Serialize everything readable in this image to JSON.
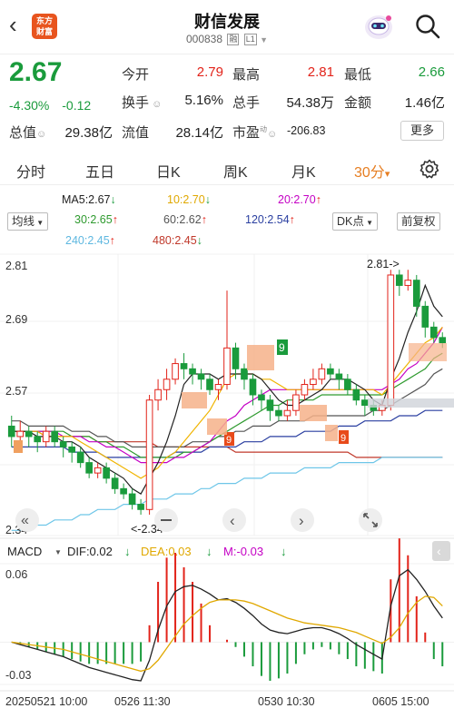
{
  "header": {
    "back_glyph": "‹",
    "app_logo": "东方财富",
    "stock_name": "财信发展",
    "stock_code": "000838",
    "badge_rong": "融",
    "badge_level": "L1",
    "search_icon": "search-icon",
    "assistant_icon": "robot-icon"
  },
  "quote": {
    "price": "2.67",
    "change_pct": "-4.30%",
    "change_amt": "-0.12",
    "open_label": "今开",
    "open": "2.79",
    "high_label": "最高",
    "high": "2.81",
    "low_label": "最低",
    "low": "2.66",
    "turnover_label": "换手",
    "turnover": "5.16%",
    "volume_label": "总手",
    "volume": "54.38万",
    "amount_label": "金额",
    "amount": "1.46亿",
    "mktcap_label": "总值",
    "mktcap": "29.38亿",
    "float_label": "流值",
    "float": "28.14亿",
    "pe_label": "市盈",
    "pe_sup": "动",
    "pe": "-206.83",
    "more_label": "更多",
    "colors": {
      "up": "#e2231a",
      "down": "#1a9b3c"
    }
  },
  "tabs": {
    "items": [
      "分时",
      "五日",
      "日K",
      "周K",
      "月K"
    ],
    "active": "30分",
    "active_arrow": "▾",
    "settings_icon": "gear-icon"
  },
  "indicators": {
    "ma_type": "均线",
    "ma5": "MA5:2.67",
    "ma10": "10:2.70",
    "ma20": "20:2.70",
    "ma30": "30:2.65",
    "ma60": "60:2.62",
    "ma120": "120:2.54",
    "ma240": "240:2.45",
    "ma480": "480:2.45",
    "dk_label": "DK点",
    "fq_label": "前复权",
    "colors": {
      "ma5": "#222222",
      "ma10": "#f0b400",
      "ma20": "#c400c4",
      "ma30": "#2e9a2e",
      "ma60": "#555555",
      "ma120": "#2a3fa0",
      "ma240": "#6ec6e8",
      "ma480": "#c0392b"
    }
  },
  "kchart": {
    "y_labels": [
      "2.81",
      "2.69",
      "2.57",
      "2.34"
    ],
    "high_marker": "2.81->",
    "low_marker": "<-2.34",
    "tick_9": "9",
    "nav_left_double": "«",
    "nav_left": "‹",
    "nav_right": "›",
    "nav_right_double": "»",
    "expand_icon": "expand-icon"
  },
  "macd": {
    "name": "MACD",
    "dif": "DIF:0.02",
    "dea": "DEA:0.03",
    "m": "M:-0.03",
    "y_top": "0.06",
    "y_bottom": "-0.03",
    "collapse_icon": "chevron-left-icon"
  },
  "timeline": {
    "labels": [
      "20250521 10:00",
      "0526 11:30",
      "0530 10:30",
      "0605 15:00"
    ]
  },
  "chart_data": {
    "type": "candlestick",
    "title": "",
    "y_range": [
      2.3,
      2.84
    ],
    "candles": [
      [
        2.51,
        2.49,
        2.53,
        2.47
      ],
      [
        2.49,
        2.5,
        2.52,
        2.48
      ],
      [
        2.5,
        2.49,
        2.51,
        2.47
      ],
      [
        2.49,
        2.48,
        2.5,
        2.46
      ],
      [
        2.48,
        2.5,
        2.51,
        2.47
      ],
      [
        2.5,
        2.48,
        2.51,
        2.47
      ],
      [
        2.48,
        2.47,
        2.49,
        2.45
      ],
      [
        2.47,
        2.46,
        2.48,
        2.44
      ],
      [
        2.46,
        2.44,
        2.47,
        2.43
      ],
      [
        2.44,
        2.42,
        2.45,
        2.41
      ],
      [
        2.42,
        2.43,
        2.44,
        2.41
      ],
      [
        2.43,
        2.41,
        2.44,
        2.4
      ],
      [
        2.41,
        2.39,
        2.42,
        2.38
      ],
      [
        2.39,
        2.38,
        2.4,
        2.37
      ],
      [
        2.38,
        2.36,
        2.39,
        2.35
      ],
      [
        2.36,
        2.35,
        2.37,
        2.34
      ],
      [
        2.35,
        2.56,
        2.57,
        2.34
      ],
      [
        2.56,
        2.58,
        2.6,
        2.54
      ],
      [
        2.58,
        2.6,
        2.62,
        2.56
      ],
      [
        2.6,
        2.63,
        2.64,
        2.59
      ],
      [
        2.63,
        2.62,
        2.65,
        2.6
      ],
      [
        2.62,
        2.61,
        2.63,
        2.59
      ],
      [
        2.61,
        2.6,
        2.62,
        2.58
      ],
      [
        2.6,
        2.58,
        2.61,
        2.57
      ],
      [
        2.58,
        2.59,
        2.6,
        2.56
      ],
      [
        2.59,
        2.66,
        2.77,
        2.58
      ],
      [
        2.66,
        2.62,
        2.67,
        2.6
      ],
      [
        2.62,
        2.6,
        2.63,
        2.58
      ],
      [
        2.6,
        2.57,
        2.61,
        2.55
      ],
      [
        2.57,
        2.56,
        2.58,
        2.54
      ],
      [
        2.56,
        2.54,
        2.57,
        2.52
      ],
      [
        2.54,
        2.53,
        2.55,
        2.52
      ],
      [
        2.53,
        2.54,
        2.56,
        2.52
      ],
      [
        2.54,
        2.57,
        2.58,
        2.53
      ],
      [
        2.57,
        2.59,
        2.6,
        2.56
      ],
      [
        2.59,
        2.6,
        2.62,
        2.58
      ],
      [
        2.6,
        2.62,
        2.63,
        2.59
      ],
      [
        2.62,
        2.61,
        2.63,
        2.6
      ],
      [
        2.61,
        2.6,
        2.62,
        2.58
      ],
      [
        2.6,
        2.58,
        2.61,
        2.57
      ],
      [
        2.58,
        2.56,
        2.59,
        2.55
      ],
      [
        2.56,
        2.55,
        2.57,
        2.53
      ],
      [
        2.55,
        2.54,
        2.56,
        2.53
      ],
      [
        2.54,
        2.55,
        2.56,
        2.53
      ],
      [
        2.55,
        2.8,
        2.81,
        2.54
      ],
      [
        2.8,
        2.78,
        2.81,
        2.76
      ],
      [
        2.78,
        2.79,
        2.81,
        2.77
      ],
      [
        2.79,
        2.74,
        2.8,
        2.72
      ],
      [
        2.74,
        2.7,
        2.75,
        2.68
      ],
      [
        2.7,
        2.68,
        2.71,
        2.67
      ],
      [
        2.68,
        2.67,
        2.69,
        2.66
      ]
    ],
    "ma5": [
      2.5,
      2.5,
      2.5,
      2.49,
      2.49,
      2.49,
      2.48,
      2.48,
      2.47,
      2.45,
      2.44,
      2.43,
      2.42,
      2.41,
      2.39,
      2.38,
      2.41,
      2.44,
      2.48,
      2.53,
      2.59,
      2.61,
      2.61,
      2.61,
      2.6,
      2.61,
      2.61,
      2.61,
      2.61,
      2.6,
      2.58,
      2.56,
      2.55,
      2.55,
      2.56,
      2.57,
      2.58,
      2.6,
      2.6,
      2.6,
      2.59,
      2.58,
      2.56,
      2.55,
      2.6,
      2.64,
      2.69,
      2.73,
      2.78,
      2.74,
      2.72
    ],
    "ma10": [
      2.5,
      2.5,
      2.5,
      2.5,
      2.49,
      2.49,
      2.49,
      2.49,
      2.48,
      2.47,
      2.46,
      2.45,
      2.44,
      2.43,
      2.42,
      2.41,
      2.42,
      2.43,
      2.45,
      2.46,
      2.48,
      2.5,
      2.52,
      2.54,
      2.57,
      2.6,
      2.61,
      2.61,
      2.61,
      2.6,
      2.6,
      2.59,
      2.58,
      2.58,
      2.58,
      2.58,
      2.58,
      2.58,
      2.58,
      2.58,
      2.58,
      2.58,
      2.58,
      2.57,
      2.59,
      2.61,
      2.63,
      2.65,
      2.67,
      2.68,
      2.7
    ],
    "ma20": [
      2.5,
      2.5,
      2.5,
      2.5,
      2.5,
      2.5,
      2.49,
      2.49,
      2.49,
      2.48,
      2.48,
      2.47,
      2.47,
      2.46,
      2.45,
      2.44,
      2.44,
      2.44,
      2.44,
      2.45,
      2.45,
      2.46,
      2.47,
      2.48,
      2.5,
      2.52,
      2.53,
      2.55,
      2.56,
      2.57,
      2.58,
      2.58,
      2.58,
      2.58,
      2.58,
      2.58,
      2.58,
      2.58,
      2.58,
      2.58,
      2.58,
      2.58,
      2.58,
      2.58,
      2.59,
      2.6,
      2.62,
      2.63,
      2.65,
      2.67,
      2.7
    ],
    "ma30": [
      2.5,
      2.5,
      2.5,
      2.5,
      2.5,
      2.5,
      2.5,
      2.49,
      2.49,
      2.49,
      2.48,
      2.48,
      2.47,
      2.47,
      2.46,
      2.45,
      2.45,
      2.45,
      2.45,
      2.45,
      2.46,
      2.46,
      2.47,
      2.48,
      2.49,
      2.5,
      2.51,
      2.52,
      2.53,
      2.54,
      2.55,
      2.55,
      2.56,
      2.56,
      2.56,
      2.56,
      2.57,
      2.57,
      2.57,
      2.57,
      2.57,
      2.57,
      2.57,
      2.57,
      2.58,
      2.59,
      2.6,
      2.61,
      2.62,
      2.64,
      2.65
    ],
    "ma60": [
      2.52,
      2.52,
      2.51,
      2.51,
      2.51,
      2.51,
      2.51,
      2.5,
      2.5,
      2.5,
      2.49,
      2.49,
      2.48,
      2.48,
      2.47,
      2.47,
      2.47,
      2.47,
      2.47,
      2.47,
      2.47,
      2.48,
      2.48,
      2.48,
      2.49,
      2.49,
      2.5,
      2.5,
      2.51,
      2.51,
      2.51,
      2.52,
      2.52,
      2.52,
      2.52,
      2.53,
      2.53,
      2.53,
      2.53,
      2.53,
      2.53,
      2.53,
      2.54,
      2.54,
      2.55,
      2.56,
      2.57,
      2.58,
      2.59,
      2.61,
      2.62
    ],
    "ma120": [
      2.47,
      2.47,
      2.47,
      2.47,
      2.47,
      2.47,
      2.47,
      2.46,
      2.46,
      2.46,
      2.46,
      2.45,
      2.45,
      2.45,
      2.45,
      2.45,
      2.45,
      2.45,
      2.45,
      2.46,
      2.46,
      2.46,
      2.46,
      2.47,
      2.47,
      2.47,
      2.47,
      2.48,
      2.48,
      2.48,
      2.49,
      2.49,
      2.49,
      2.49,
      2.5,
      2.5,
      2.5,
      2.5,
      2.51,
      2.51,
      2.51,
      2.52,
      2.52,
      2.52,
      2.52,
      2.53,
      2.53,
      2.53,
      2.54,
      2.54,
      2.54
    ],
    "ma240": [
      2.31,
      2.31,
      2.32,
      2.32,
      2.32,
      2.33,
      2.33,
      2.33,
      2.34,
      2.34,
      2.35,
      2.35,
      2.35,
      2.36,
      2.36,
      2.36,
      2.37,
      2.37,
      2.37,
      2.38,
      2.38,
      2.38,
      2.39,
      2.39,
      2.4,
      2.4,
      2.4,
      2.41,
      2.41,
      2.41,
      2.42,
      2.42,
      2.42,
      2.42,
      2.43,
      2.43,
      2.43,
      2.43,
      2.44,
      2.44,
      2.44,
      2.44,
      2.44,
      2.45,
      2.45,
      2.45,
      2.45,
      2.45,
      2.45,
      2.45,
      2.45
    ],
    "ma480": [
      2.5,
      2.5,
      2.5,
      2.5,
      2.49,
      2.49,
      2.49,
      2.49,
      2.49,
      2.49,
      2.48,
      2.48,
      2.48,
      2.48,
      2.48,
      2.48,
      2.48,
      2.47,
      2.47,
      2.47,
      2.47,
      2.47,
      2.47,
      2.47,
      2.47,
      2.47,
      2.46,
      2.46,
      2.46,
      2.46,
      2.46,
      2.46,
      2.46,
      2.46,
      2.46,
      2.46,
      2.46,
      2.46,
      2.46,
      2.46,
      2.45,
      2.45,
      2.45,
      2.45,
      2.45,
      2.45,
      2.45,
      2.45,
      2.45,
      2.45,
      2.45
    ],
    "macd_range": [
      -0.035,
      0.065
    ],
    "dif": [
      0.0,
      -0.002,
      -0.004,
      -0.006,
      -0.008,
      -0.01,
      -0.012,
      -0.015,
      -0.018,
      -0.021,
      -0.023,
      -0.025,
      -0.027,
      -0.029,
      -0.031,
      -0.032,
      -0.015,
      0.01,
      0.03,
      0.042,
      0.046,
      0.047,
      0.044,
      0.04,
      0.035,
      0.036,
      0.033,
      0.028,
      0.022,
      0.015,
      0.01,
      0.008,
      0.007,
      0.009,
      0.011,
      0.012,
      0.012,
      0.01,
      0.007,
      0.003,
      -0.002,
      -0.006,
      -0.01,
      -0.014,
      0.03,
      0.055,
      0.06,
      0.052,
      0.042,
      0.03,
      0.02
    ],
    "dea": [
      0.0,
      -0.001,
      -0.002,
      -0.003,
      -0.004,
      -0.005,
      -0.006,
      -0.008,
      -0.01,
      -0.012,
      -0.014,
      -0.016,
      -0.018,
      -0.02,
      -0.022,
      -0.024,
      -0.022,
      -0.015,
      -0.005,
      0.005,
      0.015,
      0.022,
      0.028,
      0.033,
      0.035,
      0.035,
      0.035,
      0.034,
      0.032,
      0.029,
      0.026,
      0.023,
      0.02,
      0.018,
      0.016,
      0.015,
      0.014,
      0.013,
      0.012,
      0.01,
      0.008,
      0.005,
      0.002,
      -0.001,
      0.004,
      0.012,
      0.024,
      0.033,
      0.038,
      0.037,
      0.03
    ]
  }
}
